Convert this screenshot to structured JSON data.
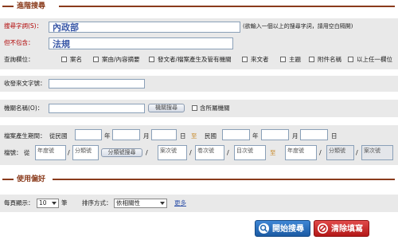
{
  "sections": {
    "advanced_search": "進階搜尋",
    "preferences": "使用偏好"
  },
  "keyword": {
    "label": "搜尋字詞(S)：",
    "value": "內政部",
    "hint": "(欲輸入一個以上的搜尋字詞，請用空白隔開)"
  },
  "exclude": {
    "label": "但不包含：",
    "value": "法規"
  },
  "fields": {
    "label": "查詢欄位：",
    "options": [
      "案名",
      "案由/內容摘要",
      "發文者/檔案產生及管有機關",
      "來文者",
      "主題",
      "附件名稱",
      "以上任一欄位"
    ]
  },
  "incoming_doc": {
    "label": "收發來文字號："
  },
  "agency": {
    "label": "機關名稱(O)：",
    "button": "機關搜尋",
    "include_sub": "含所屬機關"
  },
  "period": {
    "label": "檔案產生期間：",
    "from": "從民國",
    "year": "年",
    "month": "月",
    "day": "日",
    "to": "至",
    "roc": "民國"
  },
  "file_no": {
    "label": "檔號：",
    "from": "從",
    "year_ph": "年度號",
    "class_ph": "分類號",
    "class_btn": "分類號搜尋",
    "case_ph": "案次號",
    "vol_ph": "卷次號",
    "item_ph": "目次號",
    "to": "至"
  },
  "prefs": {
    "per_page_label": "每頁顯示：",
    "per_page_value": "10",
    "per_page_unit": "筆",
    "sort_label": "排序方式：",
    "sort_value": "依相關性",
    "more": "更多"
  },
  "actions": {
    "search": "開始搜尋",
    "clear": "清除填寫"
  },
  "colors": {
    "section": "#8a3b1c",
    "search_btn": "#1f67b3",
    "clear_btn": "#c02020"
  }
}
